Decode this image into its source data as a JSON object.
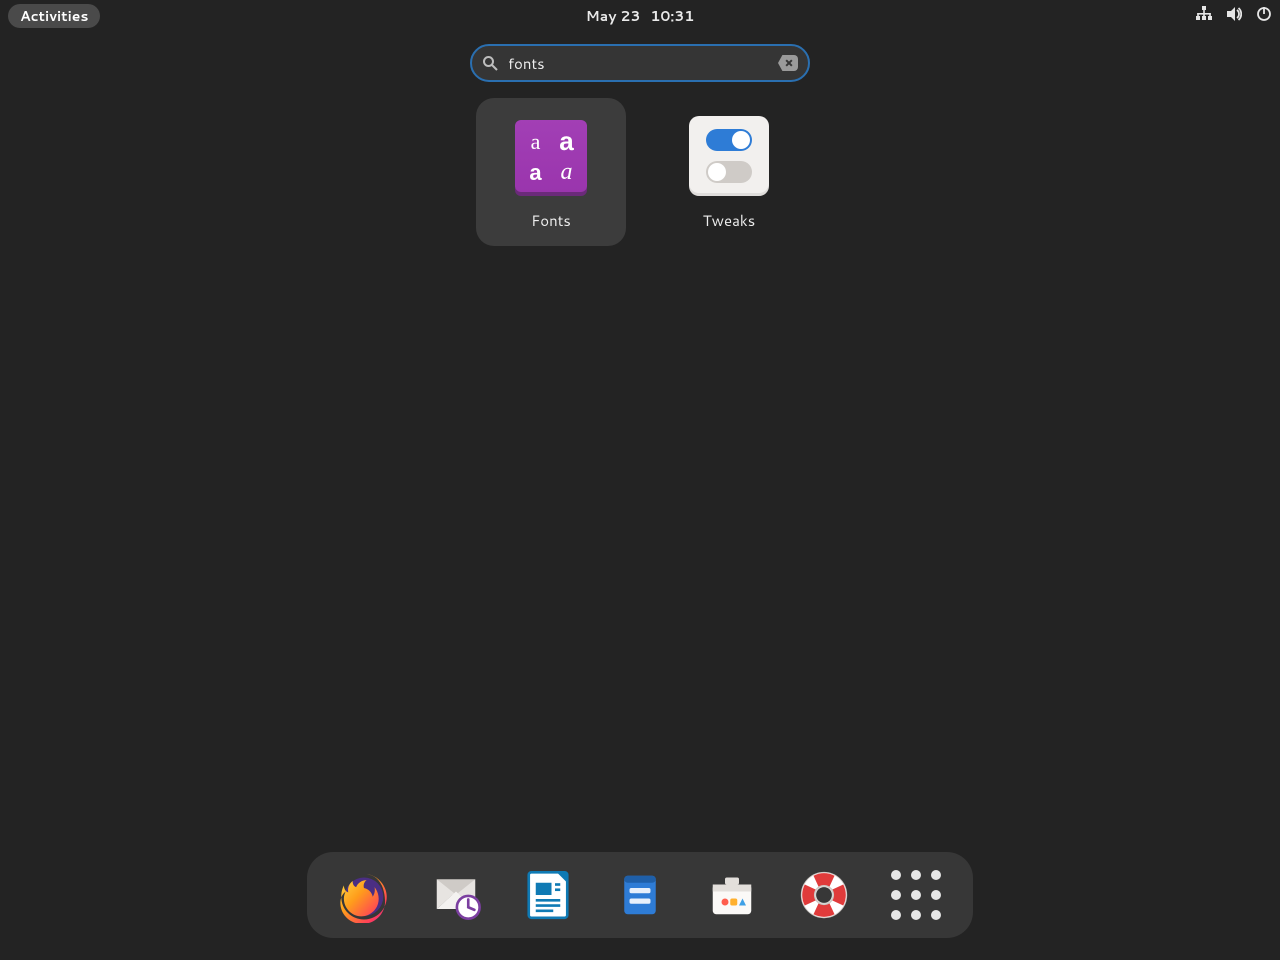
{
  "topbar": {
    "activities_label": "Activities",
    "date": "May 23",
    "time": "10:31"
  },
  "search": {
    "value": "fonts"
  },
  "results": [
    {
      "label": "Fonts",
      "icon": "fonts-icon",
      "selected": true
    },
    {
      "label": "Tweaks",
      "icon": "tweaks-icon",
      "selected": false
    }
  ],
  "dock": [
    {
      "name": "firefox",
      "icon": "firefox-icon"
    },
    {
      "name": "evolution",
      "icon": "mail-calendar-icon"
    },
    {
      "name": "libreoffice",
      "icon": "libreoffice-writer-icon"
    },
    {
      "name": "files",
      "icon": "files-icon"
    },
    {
      "name": "software",
      "icon": "software-store-icon"
    },
    {
      "name": "help",
      "icon": "help-lifering-icon"
    },
    {
      "name": "show-apps",
      "icon": "apps-grid-icon"
    }
  ]
}
